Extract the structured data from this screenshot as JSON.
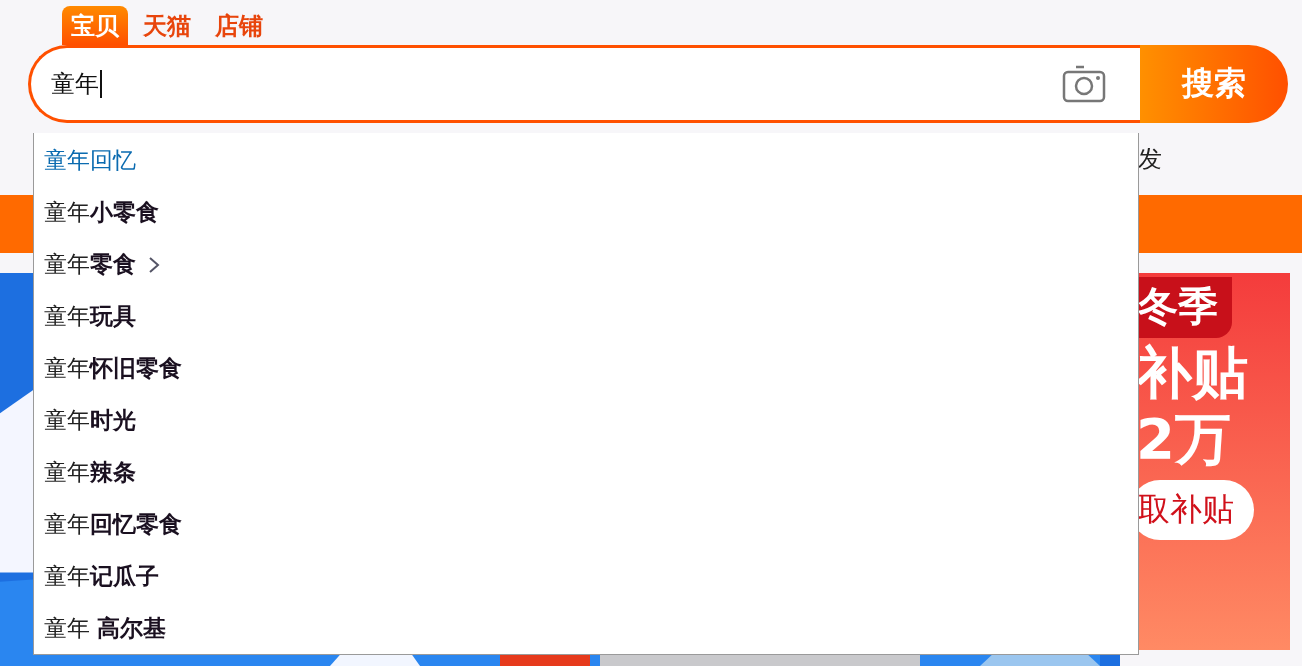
{
  "search_tabs": [
    {
      "label": "宝贝",
      "selected": true
    },
    {
      "label": "天猫",
      "selected": false
    },
    {
      "label": "店铺",
      "selected": false
    }
  ],
  "search": {
    "value": "童年",
    "button": "搜索"
  },
  "hot_words_tail": "发",
  "suggestions": [
    {
      "text": "童年回忆",
      "selected": true,
      "submenu": false
    },
    {
      "text": "童年**小零食**",
      "selected": false,
      "submenu": false
    },
    {
      "text": "童年**零食**",
      "selected": false,
      "submenu": true
    },
    {
      "text": "童年**玩具**",
      "selected": false,
      "submenu": false
    },
    {
      "text": "童年**怀旧零食**",
      "selected": false,
      "submenu": false
    },
    {
      "text": "童年**时光**",
      "selected": false,
      "submenu": false
    },
    {
      "text": "童年**辣条**",
      "selected": false,
      "submenu": false
    },
    {
      "text": "童年**回忆零食**",
      "selected": false,
      "submenu": false
    },
    {
      "text": "童年**记瓜子**",
      "selected": false,
      "submenu": false
    },
    {
      "text": "童年 **高尔基**",
      "selected": false,
      "submenu": false
    }
  ],
  "promo": {
    "heading": "冬季",
    "line_1": "补贴",
    "line_2": "2万",
    "button": "取补贴"
  }
}
